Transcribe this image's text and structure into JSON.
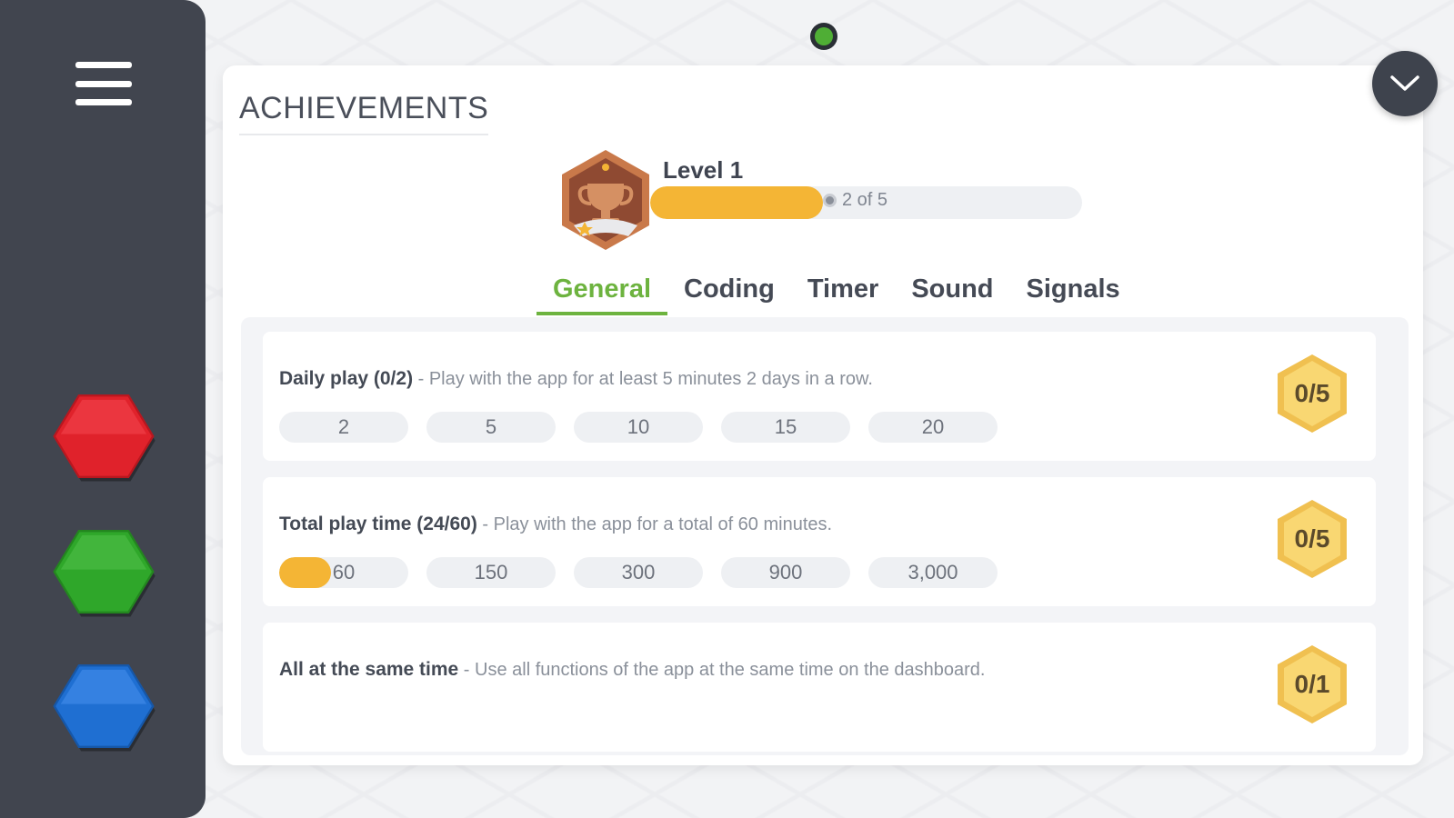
{
  "sidebar": {
    "menu_icon": "hamburger-menu-icon",
    "buttons": [
      {
        "name": "red",
        "color": "#e0222b"
      },
      {
        "name": "green",
        "color": "#2fa72a"
      },
      {
        "name": "blue",
        "color": "#1f6fd2"
      }
    ]
  },
  "panel": {
    "title": "ACHIEVEMENTS",
    "collapse_icon": "chevron-down-icon",
    "level": {
      "label": "Level 1",
      "progress_text": "2 of 5",
      "progress_fraction": 0.4,
      "badge_icon": "trophy-icon"
    },
    "tabs": [
      {
        "label": "General",
        "active": true
      },
      {
        "label": "Coding",
        "active": false
      },
      {
        "label": "Timer",
        "active": false
      },
      {
        "label": "Sound",
        "active": false
      },
      {
        "label": "Signals",
        "active": false
      }
    ],
    "achievements": [
      {
        "title": "Daily play (0/2)",
        "description": " - Play with the app for at least 5 minutes 2 days in a row.",
        "badge": "0/5",
        "steps": [
          {
            "label": "2",
            "fill": 0
          },
          {
            "label": "5",
            "fill": 0
          },
          {
            "label": "10",
            "fill": 0
          },
          {
            "label": "15",
            "fill": 0
          },
          {
            "label": "20",
            "fill": 0
          }
        ]
      },
      {
        "title": "Total play time (24/60)",
        "description": " - Play with the app for a total of 60 minutes.",
        "badge": "0/5",
        "steps": [
          {
            "label": "60",
            "fill": 0.4
          },
          {
            "label": "150",
            "fill": 0
          },
          {
            "label": "300",
            "fill": 0
          },
          {
            "label": "900",
            "fill": 0
          },
          {
            "label": "3,000",
            "fill": 0
          }
        ]
      },
      {
        "title": "All at the same time",
        "description": " - Use all functions of the app at the same time on the dashboard.",
        "badge": "0/1",
        "steps": []
      }
    ]
  },
  "colors": {
    "accent_green": "#6db33f",
    "progress_yellow": "#f4b535",
    "badge_gold": "#f7cd55",
    "sidebar": "#41454f"
  }
}
